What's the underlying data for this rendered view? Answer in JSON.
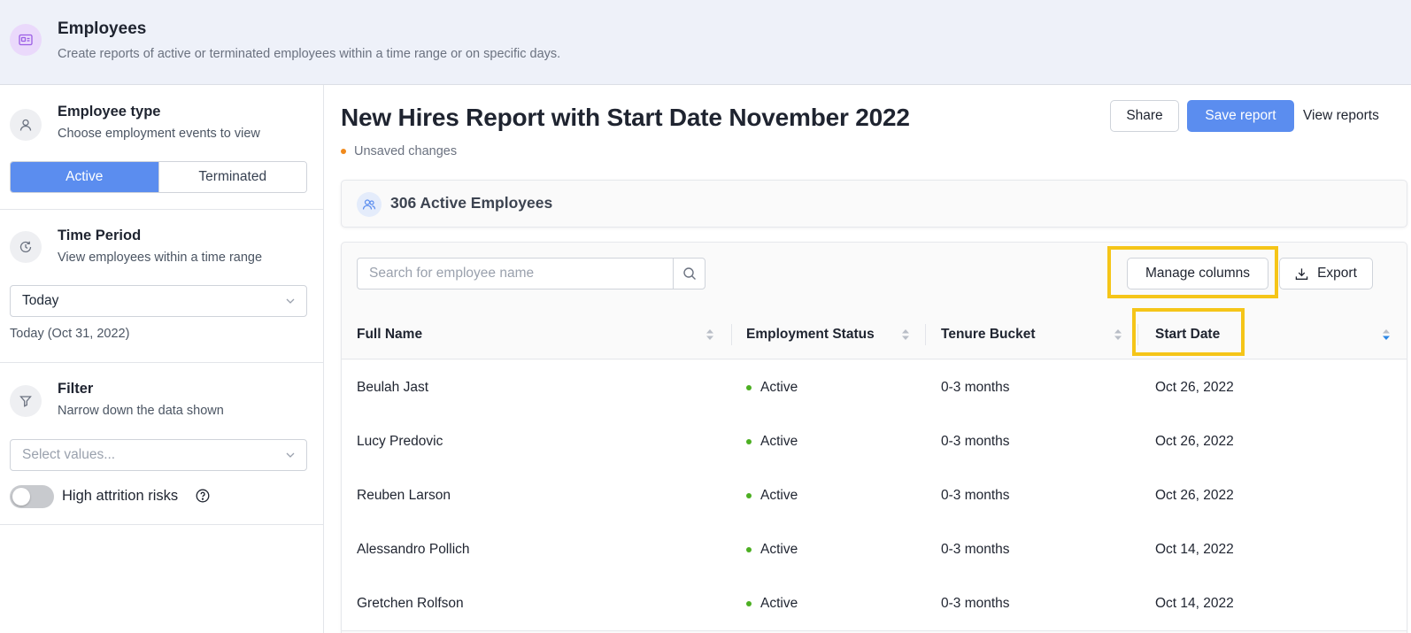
{
  "header": {
    "title": "Employees",
    "subtitle": "Create reports of active or terminated employees within a time range or on specific days.",
    "icon": "id-card-icon"
  },
  "sidebar": {
    "employee_type": {
      "title": "Employee type",
      "subtitle": "Choose employment events to view",
      "options": [
        "Active",
        "Terminated"
      ],
      "selected": "Active"
    },
    "time_period": {
      "title": "Time Period",
      "subtitle": "View employees within a time range",
      "selected_value": "Today",
      "note": "Today (Oct 31, 2022)"
    },
    "filter": {
      "title": "Filter",
      "subtitle": "Narrow down the data shown",
      "placeholder": "Select values...",
      "toggle_label": "High attrition risks",
      "toggle_on": false
    }
  },
  "report": {
    "title": "New Hires Report with Start Date November 2022",
    "unsaved_label": "Unsaved changes",
    "share_label": "Share",
    "save_label": "Save report",
    "view_label": "View reports",
    "count_label": "306 Active Employees"
  },
  "table": {
    "search_placeholder": "Search for employee name",
    "manage_columns_label": "Manage columns",
    "export_label": "Export",
    "columns": [
      "Full Name",
      "Employment Status",
      "Tenure Bucket",
      "Start Date"
    ],
    "sorted_column": "Start Date",
    "rows": [
      {
        "name": "Beulah Jast",
        "status": "Active",
        "tenure": "0-3 months",
        "start": "Oct 26, 2022"
      },
      {
        "name": "Lucy Predovic",
        "status": "Active",
        "tenure": "0-3 months",
        "start": "Oct 26, 2022"
      },
      {
        "name": "Reuben Larson",
        "status": "Active",
        "tenure": "0-3 months",
        "start": "Oct 26, 2022"
      },
      {
        "name": "Alessandro Pollich",
        "status": "Active",
        "tenure": "0-3 months",
        "start": "Oct 14, 2022"
      },
      {
        "name": "Gretchen Rolfson",
        "status": "Active",
        "tenure": "0-3 months",
        "start": "Oct 14, 2022"
      }
    ]
  },
  "colors": {
    "primary": "#5b8def",
    "highlight": "#f5c518",
    "active_dot": "#4caf22",
    "unsaved_dot": "#f08a1c",
    "header_bg": "#eef1f9"
  }
}
